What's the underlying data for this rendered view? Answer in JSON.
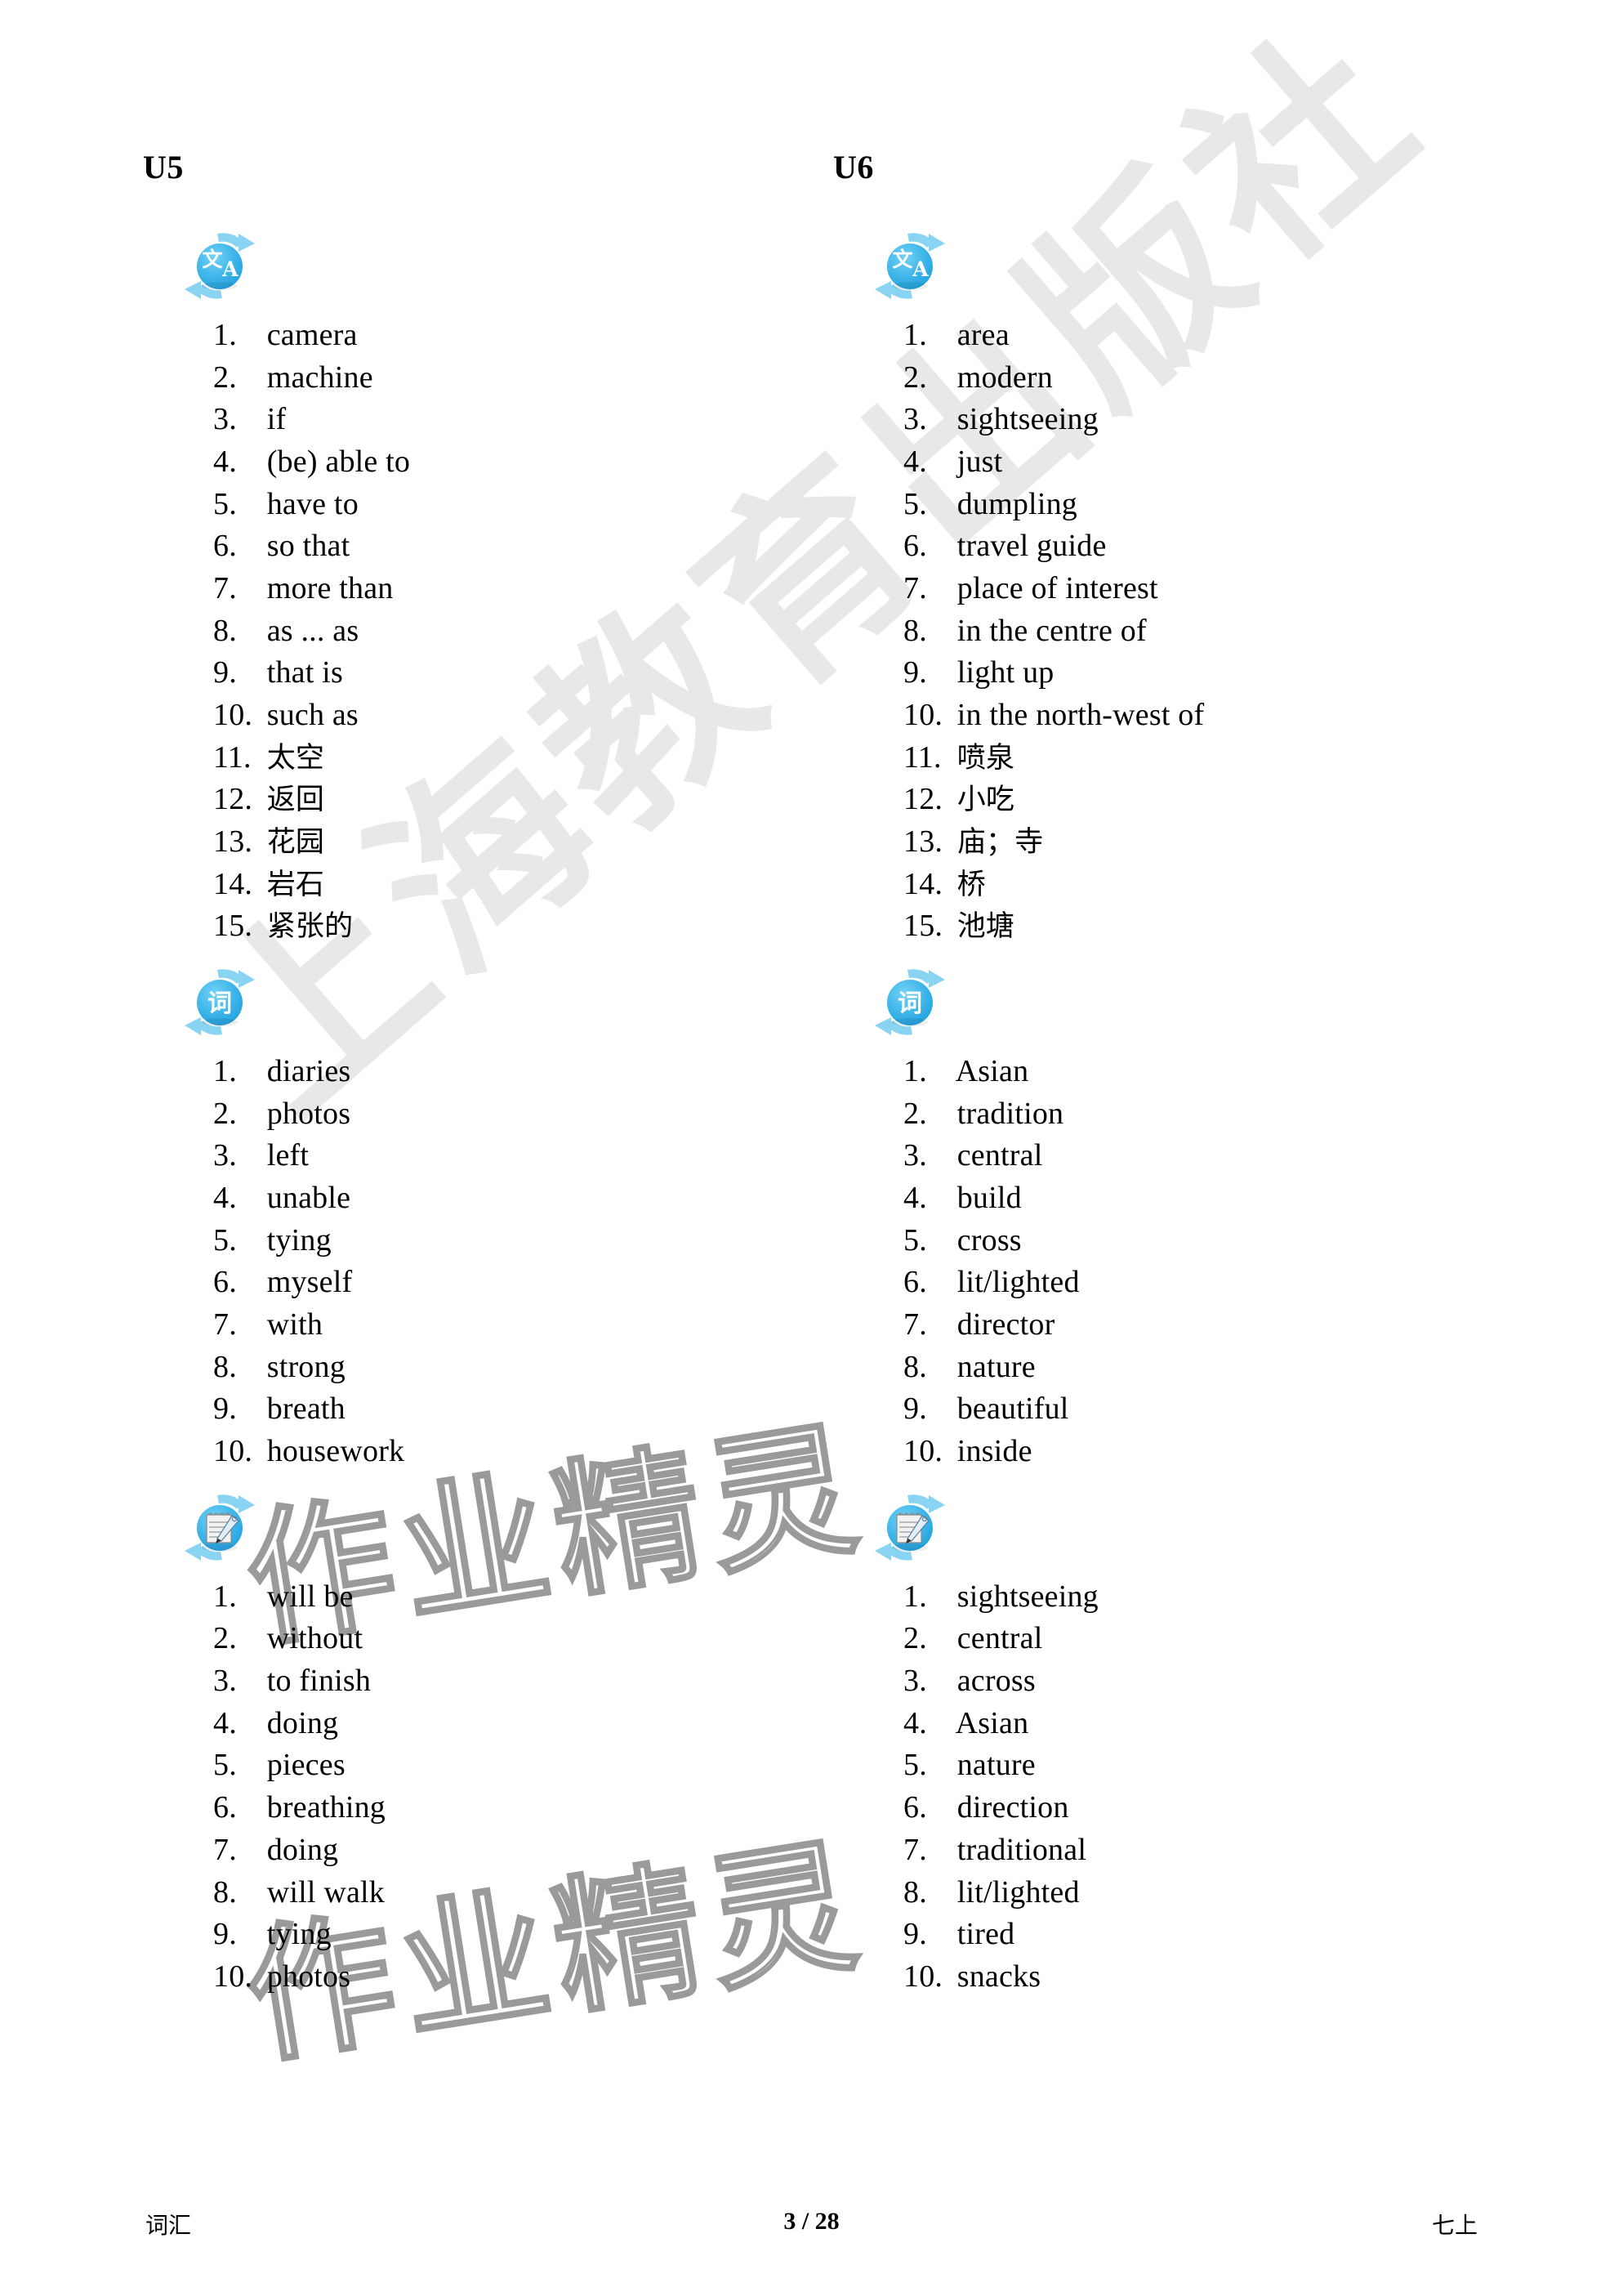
{
  "footer": {
    "left_label": "词汇",
    "page_indicator": "3 / 28",
    "right_label": "七上"
  },
  "watermarks": {
    "publisher": "上海教育出版社",
    "brand": "作业精灵",
    "publisher_color": "#e8e8e8",
    "brand_outline_color": "#9a9a9a"
  },
  "icons": {
    "translate": {
      "name": "translate-icon",
      "glyph_cn": "文",
      "glyph_en": "A",
      "color": "#3fb6ea"
    },
    "word": {
      "name": "word-icon",
      "glyph_cn": "词",
      "color": "#3fb6ea"
    },
    "notepad": {
      "name": "notepad-pencil-icon",
      "color": "#3fb6ea"
    }
  },
  "columns": [
    {
      "id": "u5",
      "title": "U5",
      "sections": [
        {
          "icon": "translate",
          "items": [
            "camera",
            "machine",
            "if",
            "(be) able to",
            "have to",
            "so that",
            "more than",
            "as ... as",
            "that is",
            "such as",
            "太空",
            "返回",
            "花园",
            "岩石",
            "紧张的"
          ]
        },
        {
          "icon": "word",
          "items": [
            "diaries",
            "photos",
            "left",
            "unable",
            "tying",
            "myself",
            "with",
            "strong",
            "breath",
            "housework"
          ]
        },
        {
          "icon": "notepad",
          "items": [
            "will be",
            "without",
            "to finish",
            "doing",
            "pieces",
            "breathing",
            "doing",
            "will walk",
            "tying",
            "photos"
          ]
        }
      ]
    },
    {
      "id": "u6",
      "title": "U6",
      "sections": [
        {
          "icon": "translate",
          "items": [
            "area",
            "modern",
            "sightseeing",
            "just",
            "dumpling",
            "travel guide",
            "place of interest",
            "in the centre of",
            "light up",
            "in the north-west of",
            "喷泉",
            "小吃",
            "庙；寺",
            "桥",
            "池塘"
          ]
        },
        {
          "icon": "word",
          "items": [
            "Asian",
            "tradition",
            "central",
            "build",
            "cross",
            "lit/lighted",
            "director",
            "nature",
            "beautiful",
            "inside"
          ]
        },
        {
          "icon": "notepad",
          "items": [
            "sightseeing",
            "central",
            "across",
            "Asian",
            "nature",
            "direction",
            "traditional",
            "lit/lighted",
            "tired",
            "snacks"
          ]
        }
      ]
    }
  ]
}
